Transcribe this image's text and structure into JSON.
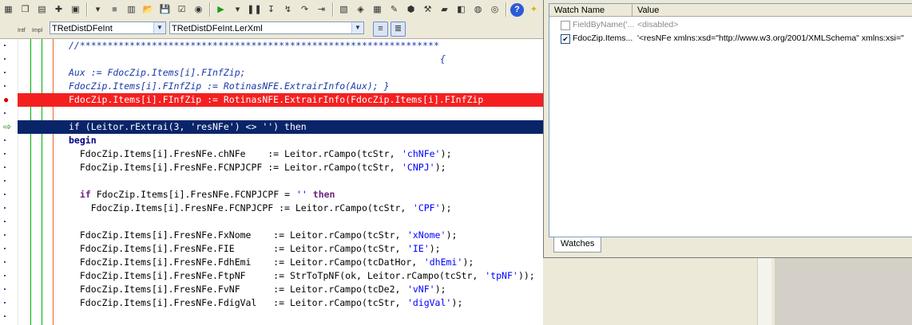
{
  "toolbar": {
    "icons": [
      "app-icon",
      "copy-icon",
      "paste-icon",
      "new-unit-icon",
      "open-icon",
      "dropdown-icon",
      "stop-gray-icon",
      "save-all-icon",
      "open-project-icon",
      "save-icon",
      "checkbox-icon",
      "toggle-icon",
      "run-icon",
      "run-dropdown-icon",
      "pause-icon",
      "step-into-icon",
      "trace-icon",
      "step-over-icon",
      "run-to-cursor-icon",
      "form-icon",
      "component-icon",
      "grid-icon",
      "edit-icon",
      "package-icon",
      "tools-icon",
      "book-icon",
      "view-icon",
      "palette-icon",
      "globe-icon",
      "help-icon",
      "tip-icon"
    ]
  },
  "combos": {
    "intf_label": "Intf",
    "impl_label": "Impl",
    "class_combo": "TRetDistDFeInt",
    "method_combo": "TRetDistDFeInt.LerXml"
  },
  "code": {
    "lines": [
      {
        "type": "comment",
        "text": "//*****************************************************************"
      },
      {
        "type": "comment",
        "text": "{"
      },
      {
        "type": "comment",
        "text": "Aux := FdocZip.Items[i].FInfZip;"
      },
      {
        "type": "comment",
        "text": "FdocZip.Items[i].FInfZip := RotinasNFE.ExtrairInfo(Aux); }"
      },
      {
        "type": "breakpoint",
        "text": "FdocZip.Items[i].FInfZip := RotinasNFE.ExtrairInfo(FdocZip.Items[i].FInfZip"
      },
      {
        "type": "blank",
        "text": ""
      },
      {
        "type": "exec",
        "text": "if (Leitor.rExtrai(3, 'resNFe') <> '') then"
      },
      {
        "type": "keyword",
        "text": "begin"
      },
      {
        "type": "code",
        "prefix": "  FdocZip.Items[i].FresNFe.chNFe    := Leitor.rCampo(tcStr, ",
        "str": "'chNFe'",
        "suffix": ");"
      },
      {
        "type": "code",
        "prefix": "  FdocZip.Items[i].FresNFe.FCNPJCPF := Leitor.rCampo(tcStr, ",
        "str": "'CNPJ'",
        "suffix": ");"
      },
      {
        "type": "blank",
        "text": ""
      },
      {
        "type": "ifline",
        "kw1": "if",
        "mid": " FdocZip.Items[i].FresNFe.FCNPJCPF = ",
        "str": "''",
        "kw2": " then"
      },
      {
        "type": "code",
        "prefix": "    FdocZip.Items[i].FresNFe.FCNPJCPF := Leitor.rCampo(tcStr, ",
        "str": "'CPF'",
        "suffix": ");"
      },
      {
        "type": "blank",
        "text": ""
      },
      {
        "type": "code",
        "prefix": "  FdocZip.Items[i].FresNFe.FxNome    := Leitor.rCampo(tcStr, ",
        "str": "'xNome'",
        "suffix": ");"
      },
      {
        "type": "code",
        "prefix": "  FdocZip.Items[i].FresNFe.FIE       := Leitor.rCampo(tcStr, ",
        "str": "'IE'",
        "suffix": ");"
      },
      {
        "type": "code",
        "prefix": "  FdocZip.Items[i].FresNFe.FdhEmi    := Leitor.rCampo(tcDatHor, ",
        "str": "'dhEmi'",
        "suffix": ");"
      },
      {
        "type": "code",
        "prefix": "  FdocZip.Items[i].FresNFe.FtpNF     := StrToTpNF(ok, Leitor.rCampo(tcStr, ",
        "str": "'tpNF'",
        "suffix": "));"
      },
      {
        "type": "code",
        "prefix": "  FdocZip.Items[i].FresNFe.FvNF      := Leitor.rCampo(tcDe2, ",
        "str": "'vNF'",
        "suffix": ");"
      },
      {
        "type": "code",
        "prefix": "  FdocZip.Items[i].FresNFe.FdigVal   := Leitor.rCampo(tcStr, ",
        "str": "'digVal'",
        "suffix": ");"
      }
    ]
  },
  "watches": {
    "col_name": "Watch Name",
    "col_value": "Value",
    "rows": [
      {
        "checked": false,
        "name": "FieldByName('...",
        "value": "<disabled>"
      },
      {
        "checked": true,
        "name": "FdocZip.Items...",
        "value": "'<resNFe xmlns:xsd=\"http://www.w3.org/2001/XMLSchema\" xmlns:xsi=\""
      }
    ],
    "tab_label": "Watches"
  },
  "colors": {
    "breakpoint_bg": "#f42020",
    "exec_bg": "#0a246a",
    "comment": "#1c3aa8",
    "string": "#0000ff",
    "keyword": "#000080"
  }
}
